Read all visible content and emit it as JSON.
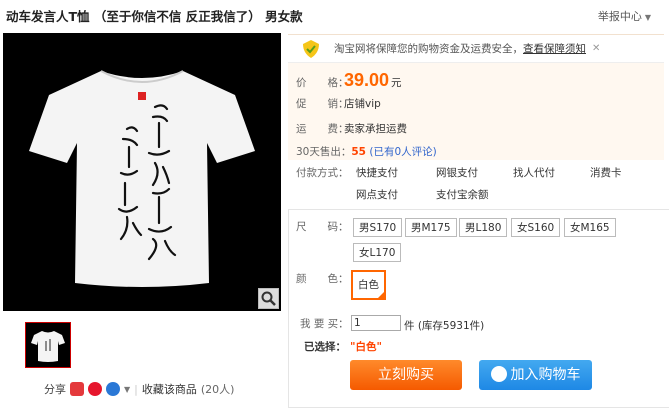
{
  "title": "动车发言人T恤 （至于你信不信 反正我信了） 男女款",
  "report": "举报中心",
  "guarantee": {
    "text": "淘宝网将保障您的购物资金及运费安全，",
    "link": "查看保障须知"
  },
  "price_label": "价　　格：",
  "price": "39.00",
  "price_unit": "元",
  "promo_label": "促　　销：",
  "promo": "店铺vip",
  "shipping_label": "运　　费：",
  "shipping": "卖家承担运费",
  "sales": {
    "label": "30天售出：",
    "count": "55",
    "comments": "(已有0人评论)"
  },
  "payment_label": "付款方式：",
  "payments": [
    "快捷支付",
    "网银支付",
    "找人代付",
    "消费卡",
    "网点支付",
    "支付宝余额"
  ],
  "size_label": "尺　　码：",
  "sizes": [
    "男S170",
    "男M175",
    "男L180",
    "女S160",
    "女M165",
    "女L170"
  ],
  "color_label": "颜　　色：",
  "colors": [
    "白色"
  ],
  "qty_label": "我 要 买：",
  "qty_value": "1",
  "qty_unit": "件 (库存5931件)",
  "selected_label": "已选择：",
  "selected_value": "\"白色\"",
  "buy_now": "立刻购买",
  "add_cart": "加入购物车",
  "share_label": "分享",
  "collect": "收藏该商品",
  "collect_count": "(20人)",
  "shirt_text": "至于你信不信 我反正信了",
  "colors_theme": {
    "accent": "#ff6600",
    "blue": "#1e88e5"
  }
}
